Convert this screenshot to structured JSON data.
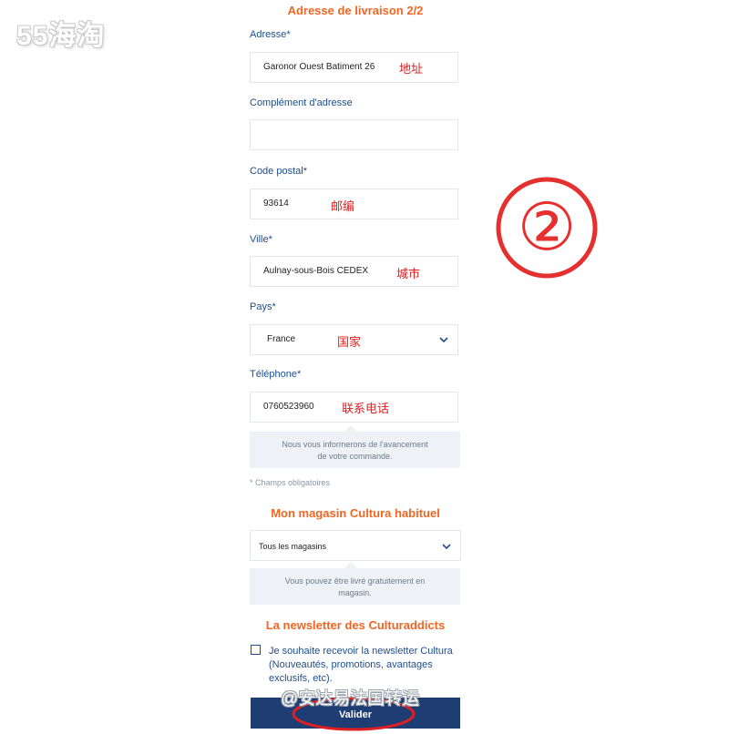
{
  "watermark": "55海淘",
  "forum_watermark": "@安达易法国转运",
  "step_marker": "②",
  "header": {
    "title": "Adresse de livraison 2/2"
  },
  "fields": {
    "address": {
      "label": "Adresse*",
      "value": "Garonor Ouest Batiment 26",
      "annotation": "地址"
    },
    "complement": {
      "label": "Complément d'adresse",
      "value": ""
    },
    "postal": {
      "label": "Code postal*",
      "value": "93614",
      "annotation": "邮编"
    },
    "city": {
      "label": "Ville*",
      "value": "Aulnay-sous-Bois CEDEX",
      "annotation": "城市"
    },
    "country": {
      "label": "Pays*",
      "value": "France",
      "annotation": "国家"
    },
    "phone": {
      "label": "Téléphone*",
      "value": "0760523960",
      "annotation": "联系电话"
    }
  },
  "phone_hint": {
    "line1": "Nous vous informerons de l'avancement",
    "line2": "de votre commande."
  },
  "required_note": "* Champs obligatoires",
  "store_section": {
    "title": "Mon magasin Cultura habituel",
    "select_value": "Tous les magasins",
    "hint_line1": "Vous pouvez être livré gratuitement en",
    "hint_line2": "magasin."
  },
  "newsletter": {
    "title": "La newsletter des Culturaddicts",
    "checkbox_label": "Je souhaite recevoir la newsletter Cultura (Nouveautés, promotions, avantages exclusifs, etc)."
  },
  "submit_label": "Valider",
  "colors": {
    "accent_orange": "#f26522",
    "label_blue": "#1f4e8c",
    "button_navy": "#1e3d73",
    "annotation_red": "#e02020"
  }
}
